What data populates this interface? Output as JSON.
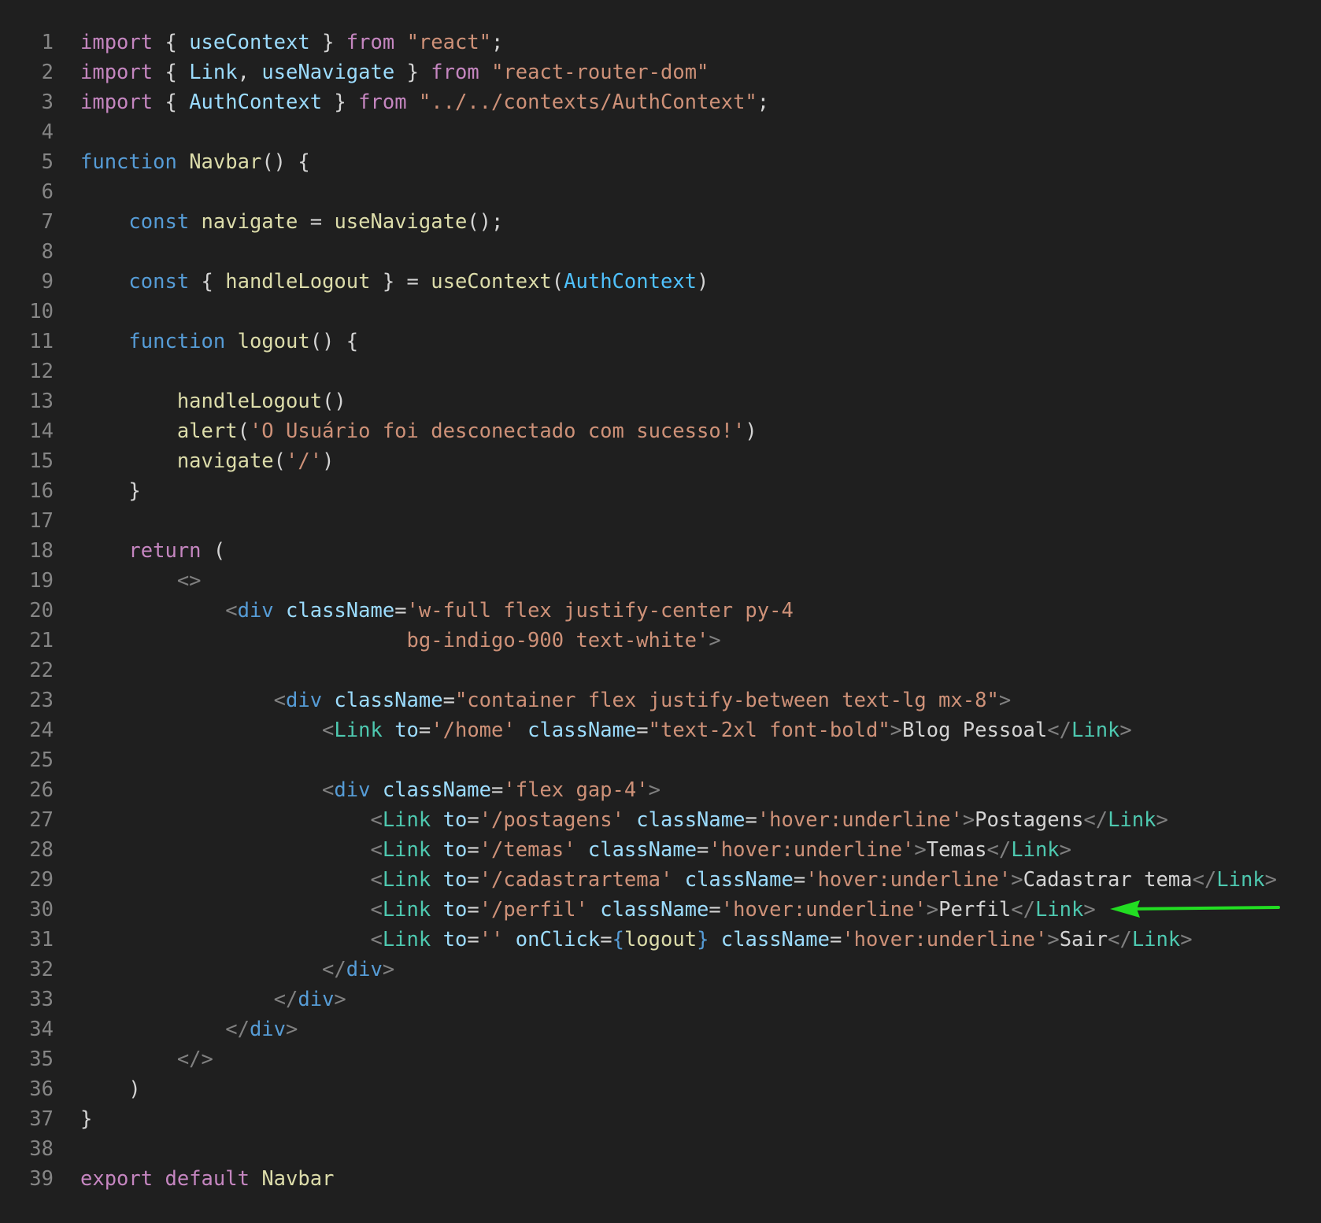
{
  "editor": {
    "theme": "dark",
    "background": "#1f1f1f",
    "colors": {
      "keyword": "#c586c0",
      "storage": "#569cd6",
      "function": "#dcdcaa",
      "variable": "#9cdcfe",
      "string": "#ce9178",
      "tag": "#4ec9b0",
      "bracket": "#808080",
      "text": "#d4d4d4",
      "line_number": "#858585"
    },
    "lines": [
      {
        "n": "1",
        "tokens": [
          [
            "kw",
            "import"
          ],
          [
            "text",
            " { "
          ],
          [
            "var",
            "useContext"
          ],
          [
            "text",
            " } "
          ],
          [
            "kw",
            "from"
          ],
          [
            "text",
            " "
          ],
          [
            "str",
            "\"react\""
          ],
          [
            "text",
            ";"
          ]
        ]
      },
      {
        "n": "2",
        "tokens": [
          [
            "kw",
            "import"
          ],
          [
            "text",
            " { "
          ],
          [
            "var",
            "Link"
          ],
          [
            "text",
            ", "
          ],
          [
            "var",
            "useNavigate"
          ],
          [
            "text",
            " } "
          ],
          [
            "kw",
            "from"
          ],
          [
            "text",
            " "
          ],
          [
            "str",
            "\"react-router-dom\""
          ]
        ]
      },
      {
        "n": "3",
        "tokens": [
          [
            "kw",
            "import"
          ],
          [
            "text",
            " { "
          ],
          [
            "var",
            "AuthContext"
          ],
          [
            "text",
            " } "
          ],
          [
            "kw",
            "from"
          ],
          [
            "text",
            " "
          ],
          [
            "str",
            "\"../../contexts/AuthContext\""
          ],
          [
            "text",
            ";"
          ]
        ]
      },
      {
        "n": "4",
        "tokens": []
      },
      {
        "n": "5",
        "tokens": [
          [
            "st",
            "function"
          ],
          [
            "text",
            " "
          ],
          [
            "fn",
            "Navbar"
          ],
          [
            "text",
            "() {"
          ]
        ]
      },
      {
        "n": "6",
        "tokens": []
      },
      {
        "n": "7",
        "tokens": [
          [
            "text",
            "    "
          ],
          [
            "st",
            "const"
          ],
          [
            "text",
            " "
          ],
          [
            "fn",
            "navigate"
          ],
          [
            "text",
            " = "
          ],
          [
            "fn",
            "useNavigate"
          ],
          [
            "text",
            "();"
          ]
        ]
      },
      {
        "n": "8",
        "tokens": []
      },
      {
        "n": "9",
        "tokens": [
          [
            "text",
            "    "
          ],
          [
            "st",
            "const"
          ],
          [
            "text",
            " { "
          ],
          [
            "fn",
            "handleLogout"
          ],
          [
            "text",
            " } = "
          ],
          [
            "fn",
            "useContext"
          ],
          [
            "text",
            "("
          ],
          [
            "cls",
            "AuthContext"
          ],
          [
            "text",
            ")"
          ]
        ]
      },
      {
        "n": "10",
        "tokens": []
      },
      {
        "n": "11",
        "tokens": [
          [
            "text",
            "    "
          ],
          [
            "st",
            "function"
          ],
          [
            "text",
            " "
          ],
          [
            "fn",
            "logout"
          ],
          [
            "text",
            "() {"
          ]
        ]
      },
      {
        "n": "12",
        "tokens": []
      },
      {
        "n": "13",
        "tokens": [
          [
            "text",
            "        "
          ],
          [
            "fn",
            "handleLogout"
          ],
          [
            "text",
            "()"
          ]
        ]
      },
      {
        "n": "14",
        "tokens": [
          [
            "text",
            "        "
          ],
          [
            "fn",
            "alert"
          ],
          [
            "text",
            "("
          ],
          [
            "str",
            "'O Usuário foi desconectado com sucesso!'"
          ],
          [
            "text",
            ")"
          ]
        ]
      },
      {
        "n": "15",
        "tokens": [
          [
            "text",
            "        "
          ],
          [
            "fn",
            "navigate"
          ],
          [
            "text",
            "("
          ],
          [
            "str",
            "'/'"
          ],
          [
            "text",
            ")"
          ]
        ]
      },
      {
        "n": "16",
        "tokens": [
          [
            "text",
            "    }"
          ]
        ]
      },
      {
        "n": "17",
        "tokens": []
      },
      {
        "n": "18",
        "tokens": [
          [
            "text",
            "    "
          ],
          [
            "kw",
            "return"
          ],
          [
            "text",
            " ("
          ]
        ]
      },
      {
        "n": "19",
        "tokens": [
          [
            "text",
            "        "
          ],
          [
            "br",
            "<>"
          ]
        ]
      },
      {
        "n": "20",
        "tokens": [
          [
            "text",
            "            "
          ],
          [
            "br",
            "<"
          ],
          [
            "blue",
            "div"
          ],
          [
            "text",
            " "
          ],
          [
            "var",
            "className"
          ],
          [
            "text",
            "="
          ],
          [
            "str",
            "'w-full flex justify-center py-4"
          ]
        ]
      },
      {
        "n": "21",
        "tokens": [
          [
            "text",
            "                           "
          ],
          [
            "str",
            "bg-indigo-900 text-white'"
          ],
          [
            "br",
            ">"
          ]
        ]
      },
      {
        "n": "22",
        "tokens": []
      },
      {
        "n": "23",
        "tokens": [
          [
            "text",
            "                "
          ],
          [
            "br",
            "<"
          ],
          [
            "blue",
            "div"
          ],
          [
            "text",
            " "
          ],
          [
            "var",
            "className"
          ],
          [
            "text",
            "="
          ],
          [
            "str",
            "\"container flex justify-between text-lg mx-8\""
          ],
          [
            "br",
            ">"
          ]
        ]
      },
      {
        "n": "24",
        "tokens": [
          [
            "text",
            "                    "
          ],
          [
            "br",
            "<"
          ],
          [
            "tag",
            "Link"
          ],
          [
            "text",
            " "
          ],
          [
            "var",
            "to"
          ],
          [
            "text",
            "="
          ],
          [
            "str",
            "'/home'"
          ],
          [
            "text",
            " "
          ],
          [
            "var",
            "className"
          ],
          [
            "text",
            "="
          ],
          [
            "str",
            "\"text-2xl font-bold\""
          ],
          [
            "br",
            ">"
          ],
          [
            "text",
            "Blog Pessoal"
          ],
          [
            "br",
            "</"
          ],
          [
            "tag",
            "Link"
          ],
          [
            "br",
            ">"
          ]
        ]
      },
      {
        "n": "25",
        "tokens": []
      },
      {
        "n": "26",
        "tokens": [
          [
            "text",
            "                    "
          ],
          [
            "br",
            "<"
          ],
          [
            "blue",
            "div"
          ],
          [
            "text",
            " "
          ],
          [
            "var",
            "className"
          ],
          [
            "text",
            "="
          ],
          [
            "str",
            "'flex gap-4'"
          ],
          [
            "br",
            ">"
          ]
        ]
      },
      {
        "n": "27",
        "tokens": [
          [
            "text",
            "                        "
          ],
          [
            "br",
            "<"
          ],
          [
            "tag",
            "Link"
          ],
          [
            "text",
            " "
          ],
          [
            "var",
            "to"
          ],
          [
            "text",
            "="
          ],
          [
            "str",
            "'/postagens'"
          ],
          [
            "text",
            " "
          ],
          [
            "var",
            "className"
          ],
          [
            "text",
            "="
          ],
          [
            "str",
            "'hover:underline'"
          ],
          [
            "br",
            ">"
          ],
          [
            "text",
            "Postagens"
          ],
          [
            "br",
            "</"
          ],
          [
            "tag",
            "Link"
          ],
          [
            "br",
            ">"
          ]
        ]
      },
      {
        "n": "28",
        "tokens": [
          [
            "text",
            "                        "
          ],
          [
            "br",
            "<"
          ],
          [
            "tag",
            "Link"
          ],
          [
            "text",
            " "
          ],
          [
            "var",
            "to"
          ],
          [
            "text",
            "="
          ],
          [
            "str",
            "'/temas'"
          ],
          [
            "text",
            " "
          ],
          [
            "var",
            "className"
          ],
          [
            "text",
            "="
          ],
          [
            "str",
            "'hover:underline'"
          ],
          [
            "br",
            ">"
          ],
          [
            "text",
            "Temas"
          ],
          [
            "br",
            "</"
          ],
          [
            "tag",
            "Link"
          ],
          [
            "br",
            ">"
          ]
        ]
      },
      {
        "n": "29",
        "tokens": [
          [
            "text",
            "                        "
          ],
          [
            "br",
            "<"
          ],
          [
            "tag",
            "Link"
          ],
          [
            "text",
            " "
          ],
          [
            "var",
            "to"
          ],
          [
            "text",
            "="
          ],
          [
            "str",
            "'/cadastrartema'"
          ],
          [
            "text",
            " "
          ],
          [
            "var",
            "className"
          ],
          [
            "text",
            "="
          ],
          [
            "str",
            "'hover:underline'"
          ],
          [
            "br",
            ">"
          ],
          [
            "text",
            "Cadastrar tema"
          ],
          [
            "br",
            "</"
          ],
          [
            "tag",
            "Link"
          ],
          [
            "br",
            ">"
          ]
        ]
      },
      {
        "n": "30",
        "tokens": [
          [
            "text",
            "                        "
          ],
          [
            "br",
            "<"
          ],
          [
            "tag",
            "Link"
          ],
          [
            "text",
            " "
          ],
          [
            "var",
            "to"
          ],
          [
            "text",
            "="
          ],
          [
            "str",
            "'/perfil'"
          ],
          [
            "text",
            " "
          ],
          [
            "var",
            "className"
          ],
          [
            "text",
            "="
          ],
          [
            "str",
            "'hover:underline'"
          ],
          [
            "br",
            ">"
          ],
          [
            "text",
            "Perfil"
          ],
          [
            "br",
            "</"
          ],
          [
            "tag",
            "Link"
          ],
          [
            "br",
            ">"
          ]
        ]
      },
      {
        "n": "31",
        "tokens": [
          [
            "text",
            "                        "
          ],
          [
            "br",
            "<"
          ],
          [
            "tag",
            "Link"
          ],
          [
            "text",
            " "
          ],
          [
            "var",
            "to"
          ],
          [
            "text",
            "="
          ],
          [
            "str",
            "''"
          ],
          [
            "text",
            " "
          ],
          [
            "var",
            "onClick"
          ],
          [
            "text",
            "="
          ],
          [
            "blue",
            "{"
          ],
          [
            "fn",
            "logout"
          ],
          [
            "blue",
            "}"
          ],
          [
            "text",
            " "
          ],
          [
            "var",
            "className"
          ],
          [
            "text",
            "="
          ],
          [
            "str",
            "'hover:underline'"
          ],
          [
            "br",
            ">"
          ],
          [
            "text",
            "Sair"
          ],
          [
            "br",
            "</"
          ],
          [
            "tag",
            "Link"
          ],
          [
            "br",
            ">"
          ]
        ]
      },
      {
        "n": "32",
        "tokens": [
          [
            "text",
            "                    "
          ],
          [
            "br",
            "</"
          ],
          [
            "blue",
            "div"
          ],
          [
            "br",
            ">"
          ]
        ]
      },
      {
        "n": "33",
        "tokens": [
          [
            "text",
            "                "
          ],
          [
            "br",
            "</"
          ],
          [
            "blue",
            "div"
          ],
          [
            "br",
            ">"
          ]
        ]
      },
      {
        "n": "34",
        "tokens": [
          [
            "text",
            "            "
          ],
          [
            "br",
            "</"
          ],
          [
            "blue",
            "div"
          ],
          [
            "br",
            ">"
          ]
        ]
      },
      {
        "n": "35",
        "tokens": [
          [
            "text",
            "        "
          ],
          [
            "br",
            "</>"
          ]
        ]
      },
      {
        "n": "36",
        "tokens": [
          [
            "text",
            "    )"
          ]
        ]
      },
      {
        "n": "37",
        "tokens": [
          [
            "text",
            "}"
          ]
        ]
      },
      {
        "n": "38",
        "tokens": []
      },
      {
        "n": "39",
        "tokens": [
          [
            "kw",
            "export"
          ],
          [
            "text",
            " "
          ],
          [
            "kw",
            "default"
          ],
          [
            "text",
            " "
          ],
          [
            "fn",
            "Navbar"
          ]
        ]
      }
    ]
  },
  "annotation": {
    "icon": "arrow-left-icon",
    "color": "#22dd22",
    "points_to_line": 30
  }
}
